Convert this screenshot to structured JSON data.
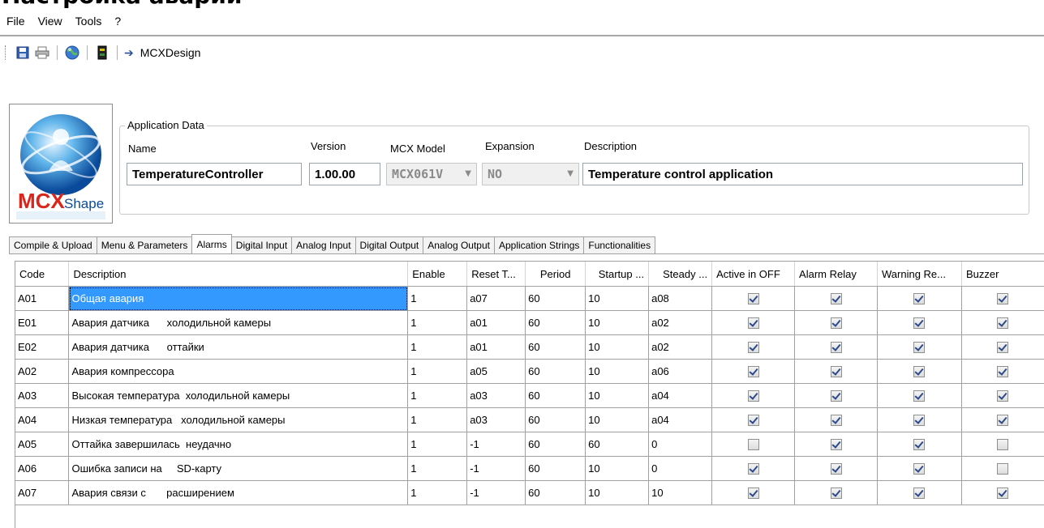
{
  "window": {
    "title": "Настройка аварий"
  },
  "menu": [
    {
      "id": "file",
      "label": "File"
    },
    {
      "id": "view",
      "label": "View"
    },
    {
      "id": "tools",
      "label": "Tools"
    },
    {
      "id": "help",
      "label": "?"
    }
  ],
  "toolbar": {
    "icons": [
      "save-icon",
      "print-icon",
      "globe-icon",
      "device-icon",
      "arrow-right-icon"
    ],
    "link_label": "MCXDesign"
  },
  "logo": {
    "text_mcx": "MCX",
    "text_shape": "Shape"
  },
  "app_data": {
    "legend": "Application Data",
    "name_label": "Name",
    "name_value": "TemperatureController",
    "version_label": "Version",
    "version_value": "1.00.00",
    "model_label": "MCX Model",
    "model_value": "MCX061V",
    "expansion_label": "Expansion",
    "expansion_value": "NO",
    "description_label": "Description",
    "description_value": "Temperature control application"
  },
  "tabs": [
    {
      "id": "compile",
      "label": "Compile & Upload"
    },
    {
      "id": "menu",
      "label": "Menu & Parameters"
    },
    {
      "id": "alarms",
      "label": "Alarms",
      "active": true
    },
    {
      "id": "digital-input",
      "label": "Digital Input"
    },
    {
      "id": "analog-input",
      "label": "Analog Input"
    },
    {
      "id": "digital-output",
      "label": "Digital Output"
    },
    {
      "id": "analog-output",
      "label": "Analog Output"
    },
    {
      "id": "app-strings",
      "label": "Application Strings"
    },
    {
      "id": "functionalities",
      "label": "Functionalities"
    }
  ],
  "grid": {
    "columns": [
      "Code",
      "Description",
      "Enable",
      "Reset T...",
      "Period",
      "Startup ...",
      "Steady ...",
      "Active in OFF",
      "Alarm Relay",
      "Warning Re...",
      "Buzzer"
    ],
    "rows": [
      {
        "code": "A01",
        "description": "Общая авария",
        "enable": "1",
        "reset": "a07",
        "period": "60",
        "startup": "10",
        "steady": "a08",
        "active_off": true,
        "alarm_relay": true,
        "warning_relay": true,
        "buzzer": true
      },
      {
        "code": "E01",
        "description": "Авария датчика      холодильной камеры",
        "enable": "1",
        "reset": "a01",
        "period": "60",
        "startup": "10",
        "steady": "a02",
        "active_off": true,
        "alarm_relay": true,
        "warning_relay": true,
        "buzzer": true
      },
      {
        "code": "E02",
        "description": "Авария датчика      оттайки",
        "enable": "1",
        "reset": "a01",
        "period": "60",
        "startup": "10",
        "steady": "a02",
        "active_off": true,
        "alarm_relay": true,
        "warning_relay": true,
        "buzzer": true
      },
      {
        "code": "A02",
        "description": "Авария компрессора",
        "enable": "1",
        "reset": "a05",
        "period": "60",
        "startup": "10",
        "steady": "a06",
        "active_off": true,
        "alarm_relay": true,
        "warning_relay": true,
        "buzzer": true
      },
      {
        "code": "A03",
        "description": "Высокая температура  холодильной камеры",
        "enable": "1",
        "reset": "a03",
        "period": "60",
        "startup": "10",
        "steady": "a04",
        "active_off": true,
        "alarm_relay": true,
        "warning_relay": true,
        "buzzer": true
      },
      {
        "code": "A04",
        "description": "Низкая температура   холодильной камеры",
        "enable": "1",
        "reset": "a03",
        "period": "60",
        "startup": "10",
        "steady": "a04",
        "active_off": true,
        "alarm_relay": true,
        "warning_relay": true,
        "buzzer": true
      },
      {
        "code": "A05",
        "description": "Оттайка завершилась  неудачно",
        "enable": "1",
        "reset": "-1",
        "period": "60",
        "startup": "60",
        "steady": "0",
        "active_off": false,
        "alarm_relay": true,
        "warning_relay": true,
        "buzzer": false
      },
      {
        "code": "A06",
        "description": "Ошибка записи на     SD-карту",
        "enable": "1",
        "reset": "-1",
        "period": "60",
        "startup": "10",
        "steady": "0",
        "active_off": true,
        "alarm_relay": true,
        "warning_relay": true,
        "buzzer": false
      },
      {
        "code": "A07",
        "description": "Авария связи с       расширением",
        "enable": "1",
        "reset": "-1",
        "period": "60",
        "startup": "10",
        "steady": "10",
        "active_off": true,
        "alarm_relay": true,
        "warning_relay": true,
        "buzzer": true
      }
    ]
  },
  "colors": {
    "selection": "#3399ff",
    "check": "#2c4a8a",
    "tab_border": "#a0a0a0"
  }
}
